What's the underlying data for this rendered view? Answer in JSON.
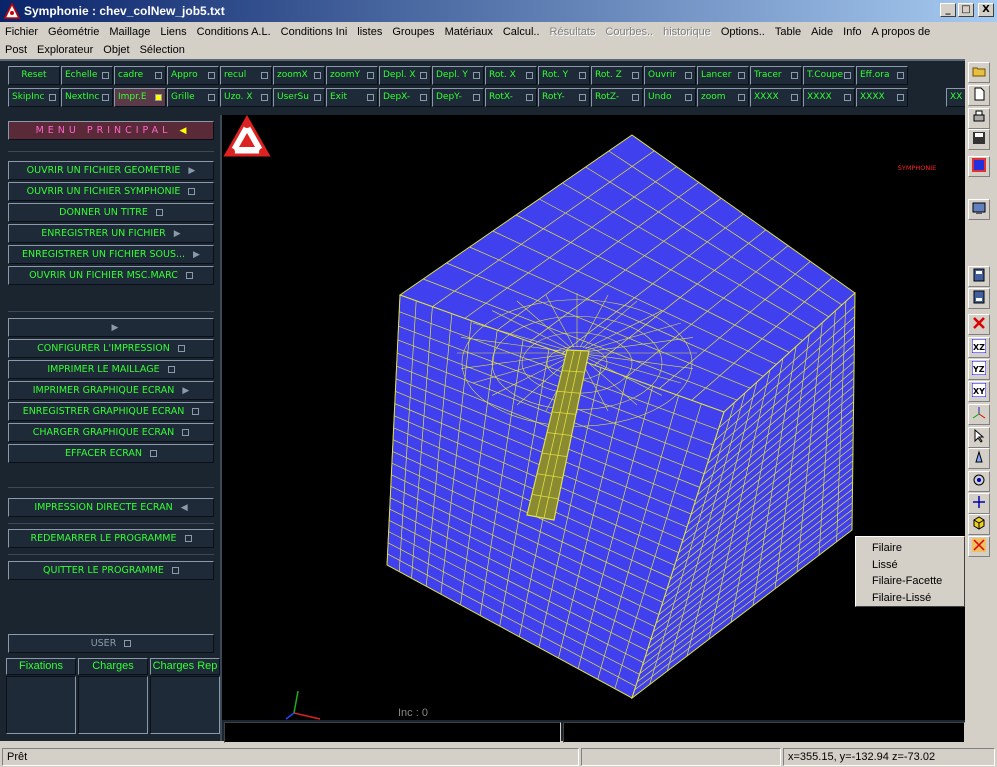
{
  "window": {
    "title": "Symphonie : chev_colNew_job5.txt",
    "buttons": {
      "minimize": "_",
      "maximize": "□",
      "close": "X"
    }
  },
  "menu_row1": [
    {
      "label": "Fichier",
      "enabled": true
    },
    {
      "label": "Géométrie",
      "enabled": true
    },
    {
      "label": "Maillage",
      "enabled": true
    },
    {
      "label": "Liens",
      "enabled": true
    },
    {
      "label": "Conditions A.L.",
      "enabled": true
    },
    {
      "label": "Conditions Ini",
      "enabled": true
    },
    {
      "label": "listes",
      "enabled": true
    },
    {
      "label": "Groupes",
      "enabled": true
    },
    {
      "label": "Matériaux",
      "enabled": true
    },
    {
      "label": "Calcul..",
      "enabled": true
    },
    {
      "label": "Résultats",
      "enabled": false
    },
    {
      "label": "Courbes..",
      "enabled": false
    },
    {
      "label": "historique",
      "enabled": false
    },
    {
      "label": "Options..",
      "enabled": true
    },
    {
      "label": "Table",
      "enabled": true
    },
    {
      "label": "Aide",
      "enabled": true
    },
    {
      "label": "Info",
      "enabled": true
    },
    {
      "label": "A propos de",
      "enabled": true
    }
  ],
  "menu_row2": [
    "Post",
    "Explorateur",
    "Objet",
    "Sélection"
  ],
  "toolbar_row1": [
    {
      "label": "Reset",
      "check": false
    },
    {
      "label": "Echelle",
      "check": true
    },
    {
      "label": "cadre",
      "check": true
    },
    {
      "label": "Appro",
      "check": true
    },
    {
      "label": "recul",
      "check": true
    },
    {
      "label": "zoomX",
      "check": true
    },
    {
      "label": "zoomY",
      "check": true
    },
    {
      "label": "Depl. X",
      "check": true
    },
    {
      "label": "Depl. Y",
      "check": true
    },
    {
      "label": "Rot. X",
      "check": true
    },
    {
      "label": "Rot. Y",
      "check": true
    },
    {
      "label": "Rot. Z",
      "check": true
    },
    {
      "label": "Ouvrir",
      "check": true
    },
    {
      "label": "Lancer",
      "check": true
    },
    {
      "label": "Tracer",
      "check": true
    },
    {
      "label": "T.Coupe",
      "check": true
    },
    {
      "label": "Eff.ora",
      "check": true
    }
  ],
  "toolbar_row2": [
    {
      "label": "SkipInc",
      "check": true
    },
    {
      "label": "NextInc",
      "check": true
    },
    {
      "label": "Impr.E",
      "check": true,
      "active": true
    },
    {
      "label": "Grille",
      "check": true
    },
    {
      "label": "Uzo. X",
      "check": true
    },
    {
      "label": "UserSu",
      "check": true
    },
    {
      "label": "Exit",
      "check": true
    },
    {
      "label": "DepX-",
      "check": true
    },
    {
      "label": "DepY-",
      "check": true
    },
    {
      "label": "RotX-",
      "check": true
    },
    {
      "label": "RotY-",
      "check": true
    },
    {
      "label": "RotZ-",
      "check": true
    },
    {
      "label": "Undo",
      "check": true
    },
    {
      "label": "zoom",
      "check": true
    },
    {
      "label": "XXXX",
      "check": true
    },
    {
      "label": "XXXX",
      "check": true
    },
    {
      "label": "XXXX",
      "check": true
    }
  ],
  "toolbar_row2_last": "XX",
  "left_menu": {
    "header": "MENU PRINCIPAL",
    "items": [
      {
        "label": "OUVRIR UN FICHIER GEOMETRIE",
        "mark": "arrow"
      },
      {
        "label": "OUVRIR UN FICHIER SYMPHONIE",
        "mark": "check"
      },
      {
        "label": "DONNER UN TITRE",
        "mark": "check"
      },
      {
        "label": "ENREGISTRER UN FICHIER",
        "mark": "arrow"
      },
      {
        "label": "ENREGISTRER UN FICHIER SOUS...",
        "mark": "arrow"
      },
      {
        "label": "OUVRIR UN FICHIER MSC.MARC",
        "mark": "check"
      }
    ],
    "items2": [
      {
        "label": "",
        "mark": "arrow"
      },
      {
        "label": "CONFIGURER L'IMPRESSION",
        "mark": "check"
      },
      {
        "label": "IMPRIMER LE MAILLAGE",
        "mark": "check"
      },
      {
        "label": "IMPRIMER GRAPHIQUE ECRAN",
        "mark": "arrow"
      },
      {
        "label": "ENREGISTRER GRAPHIQUE ECRAN",
        "mark": "check"
      },
      {
        "label": "CHARGER GRAPHIQUE ECRAN",
        "mark": "check"
      },
      {
        "label": "EFFACER ECRAN",
        "mark": "check"
      }
    ],
    "impression_directe": "IMPRESSION DIRECTE ECRAN",
    "redemarrer": "REDEMARRER LE PROGRAMME",
    "quitter": "QUITTER LE PROGRAMME",
    "user": "USER"
  },
  "tabs": [
    "Fixations",
    "Charges",
    "Charges Rep"
  ],
  "canvas": {
    "logo_text": "SYMPHONIE",
    "increment": "Inc : 0",
    "mesh_color": "#4040ee",
    "line_color": "#e0e040"
  },
  "context_menu": [
    "Filaire",
    "Lissé",
    "Filaire-Facette",
    "Filaire-Lissé"
  ],
  "status": {
    "left": "Prêt",
    "coords": "x=355.15, y=-132.94 z=-73.02"
  },
  "right_tools": [
    "open-folder-icon",
    "new-document-icon",
    "print-icon",
    "save-icon",
    "render-color-icon",
    "display-mode-icon",
    "save-view-icon",
    "restore-view-icon",
    "delete-icon",
    "view-xz-icon",
    "view-yz-icon",
    "view-xy-icon",
    "axes-icon",
    "pointer-icon",
    "light-icon",
    "target-icon",
    "move-icon",
    "cube-shade-icon",
    "scissors-icon"
  ]
}
